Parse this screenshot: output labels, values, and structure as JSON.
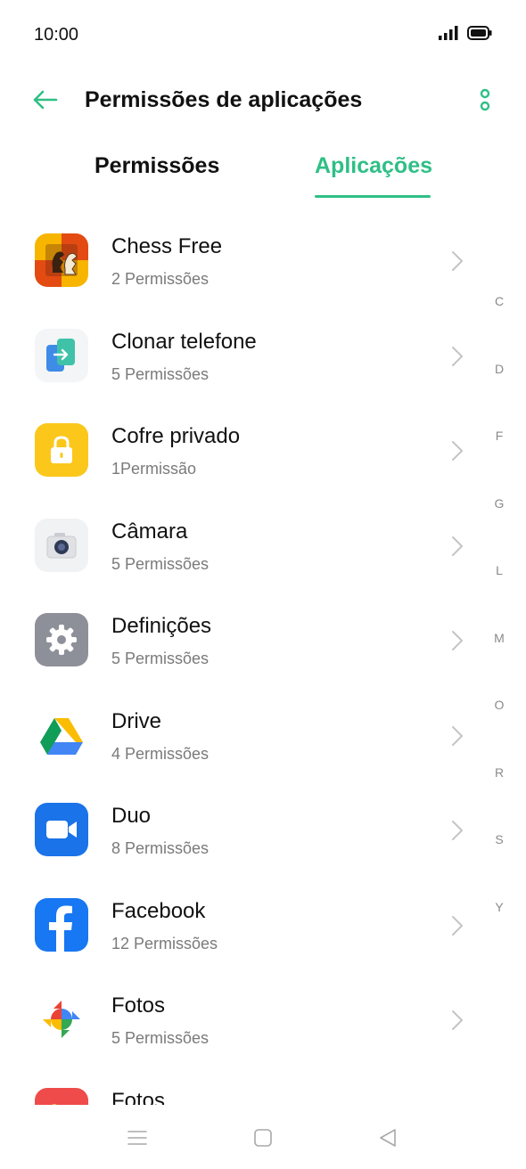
{
  "status_bar": {
    "time": "10:00"
  },
  "header": {
    "title": "Permissões de aplicações"
  },
  "tabs": [
    {
      "label": "Permissões",
      "active": false
    },
    {
      "label": "Aplicações",
      "active": true
    }
  ],
  "accent_color": "#2fbf86",
  "apps": [
    {
      "name": "Chess Free",
      "permissions": "2 Permissões",
      "icon": "chess-free-icon"
    },
    {
      "name": "Clonar telefone",
      "permissions": "5 Permissões",
      "icon": "clone-phone-icon"
    },
    {
      "name": "Cofre privado",
      "permissions": "1Permissão",
      "icon": "lock-icon"
    },
    {
      "name": "Câmara",
      "permissions": "5 Permissões",
      "icon": "camera-icon"
    },
    {
      "name": "Definições",
      "permissions": "5 Permissões",
      "icon": "settings-gear-icon"
    },
    {
      "name": "Drive",
      "permissions": "4 Permissões",
      "icon": "google-drive-icon"
    },
    {
      "name": "Duo",
      "permissions": "8 Permissões",
      "icon": "duo-video-icon"
    },
    {
      "name": "Facebook",
      "permissions": "12 Permissões",
      "icon": "facebook-icon"
    },
    {
      "name": "Fotos",
      "permissions": "5 Permissões",
      "icon": "google-photos-icon"
    },
    {
      "name": "Fotos",
      "permissions": "",
      "icon": "gallery-icon"
    }
  ],
  "index_letters": [
    "C",
    "D",
    "F",
    "G",
    "L",
    "M",
    "O",
    "R",
    "S",
    "Y"
  ]
}
